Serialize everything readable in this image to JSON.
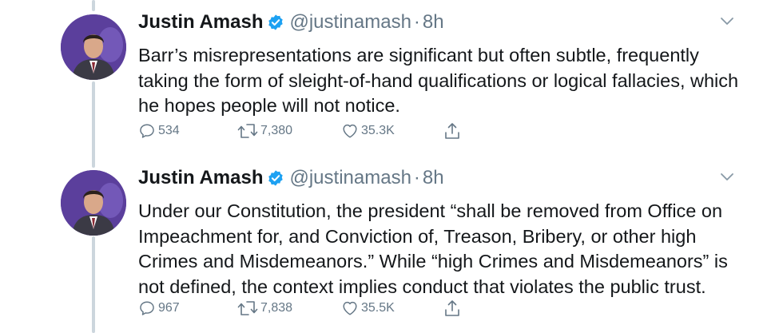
{
  "tweets": [
    {
      "name": "Justin Amash",
      "handle": "@justinamash",
      "separator": "·",
      "time": "8h",
      "text": "Barr’s misrepresentations are significant but often subtle, frequently taking the form of sleight-of-hand qualifications or logical fallacies, which he hopes people will not notice.",
      "replies": "534",
      "retweets": "7,380",
      "likes": "35.3K"
    },
    {
      "name": "Justin Amash",
      "handle": "@justinamash",
      "separator": "·",
      "time": "8h",
      "text": "Under our Constitution, the president “shall be removed from Office on Impeachment for, and Conviction of, Treason, Bribery, or other high Crimes and Misdemeanors.” While “high Crimes and Misdemeanors” is not defined, the context implies conduct that violates the public trust.",
      "replies": "967",
      "retweets": "7,838",
      "likes": "35.5K"
    }
  ],
  "icons": {
    "verified": "verified-badge-icon",
    "caret": "chevron-down-icon",
    "reply": "reply-icon",
    "retweet": "retweet-icon",
    "like": "heart-icon",
    "share": "share-icon"
  },
  "colors": {
    "text": "#14171a",
    "secondary": "#657786",
    "verified": "#1da1f2",
    "thread_line": "#ccd6dd"
  }
}
